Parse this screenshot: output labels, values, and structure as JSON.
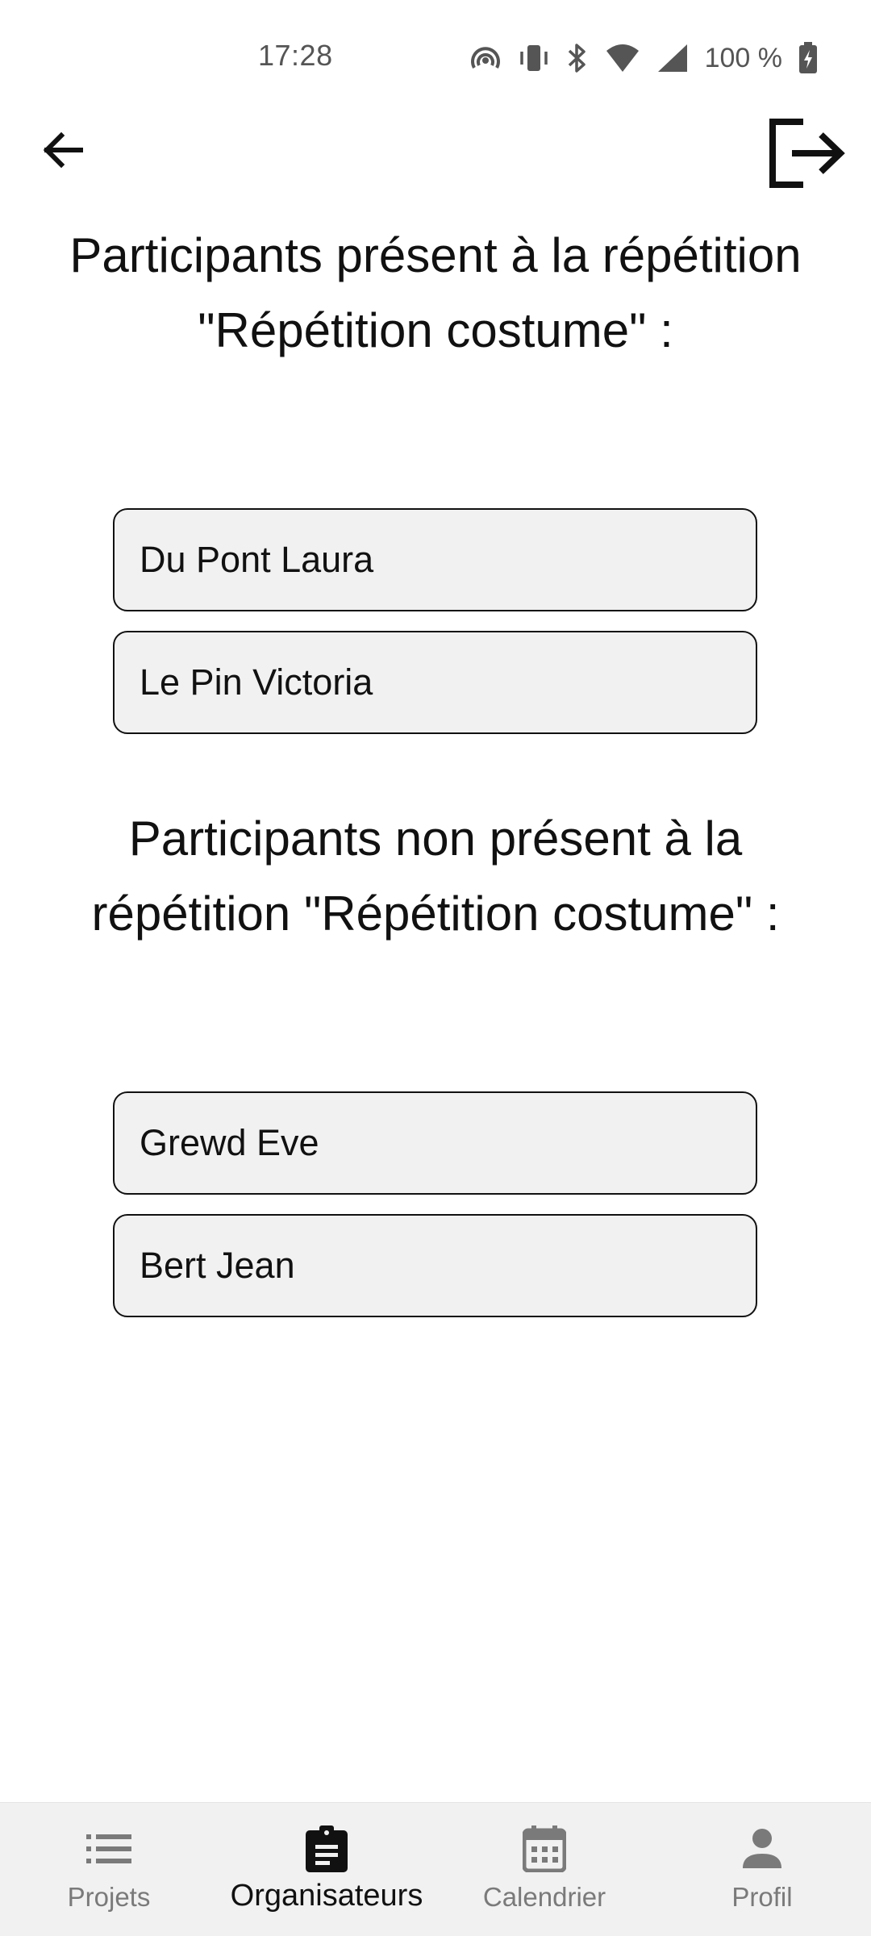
{
  "status_bar": {
    "time": "17:28",
    "battery": "100 %",
    "icons": [
      "hotspot-icon",
      "vibrate-icon",
      "bluetooth-icon",
      "wifi-icon",
      "signal-icon",
      "battery-charging-icon"
    ]
  },
  "app_bar": {
    "back_icon": "arrow-left-icon",
    "logout_icon": "logout-icon"
  },
  "present_section": {
    "title": "Participants présent à la répétition \"Répétition costume\" :",
    "participants": [
      "Du Pont Laura",
      "Le Pin Victoria"
    ]
  },
  "absent_section": {
    "title": "Participants non présent à la répétition \"Répétition costume\" :",
    "participants": [
      "Grewd Eve",
      "Bert Jean"
    ]
  },
  "bottom_nav": {
    "items": [
      {
        "label": "Projets",
        "icon": "list-icon",
        "active": false
      },
      {
        "label": "Organisateurs",
        "icon": "clipboard-icon",
        "active": true
      },
      {
        "label": "Calendrier",
        "icon": "calendar-icon",
        "active": false
      },
      {
        "label": "Profil",
        "icon": "person-icon",
        "active": false
      }
    ]
  },
  "colors": {
    "background": "#ffffff",
    "card_background": "#f1f1f1",
    "card_border": "#111111",
    "nav_background": "#f1f1f1",
    "nav_inactive": "#7a7a7a",
    "nav_active": "#111111"
  }
}
